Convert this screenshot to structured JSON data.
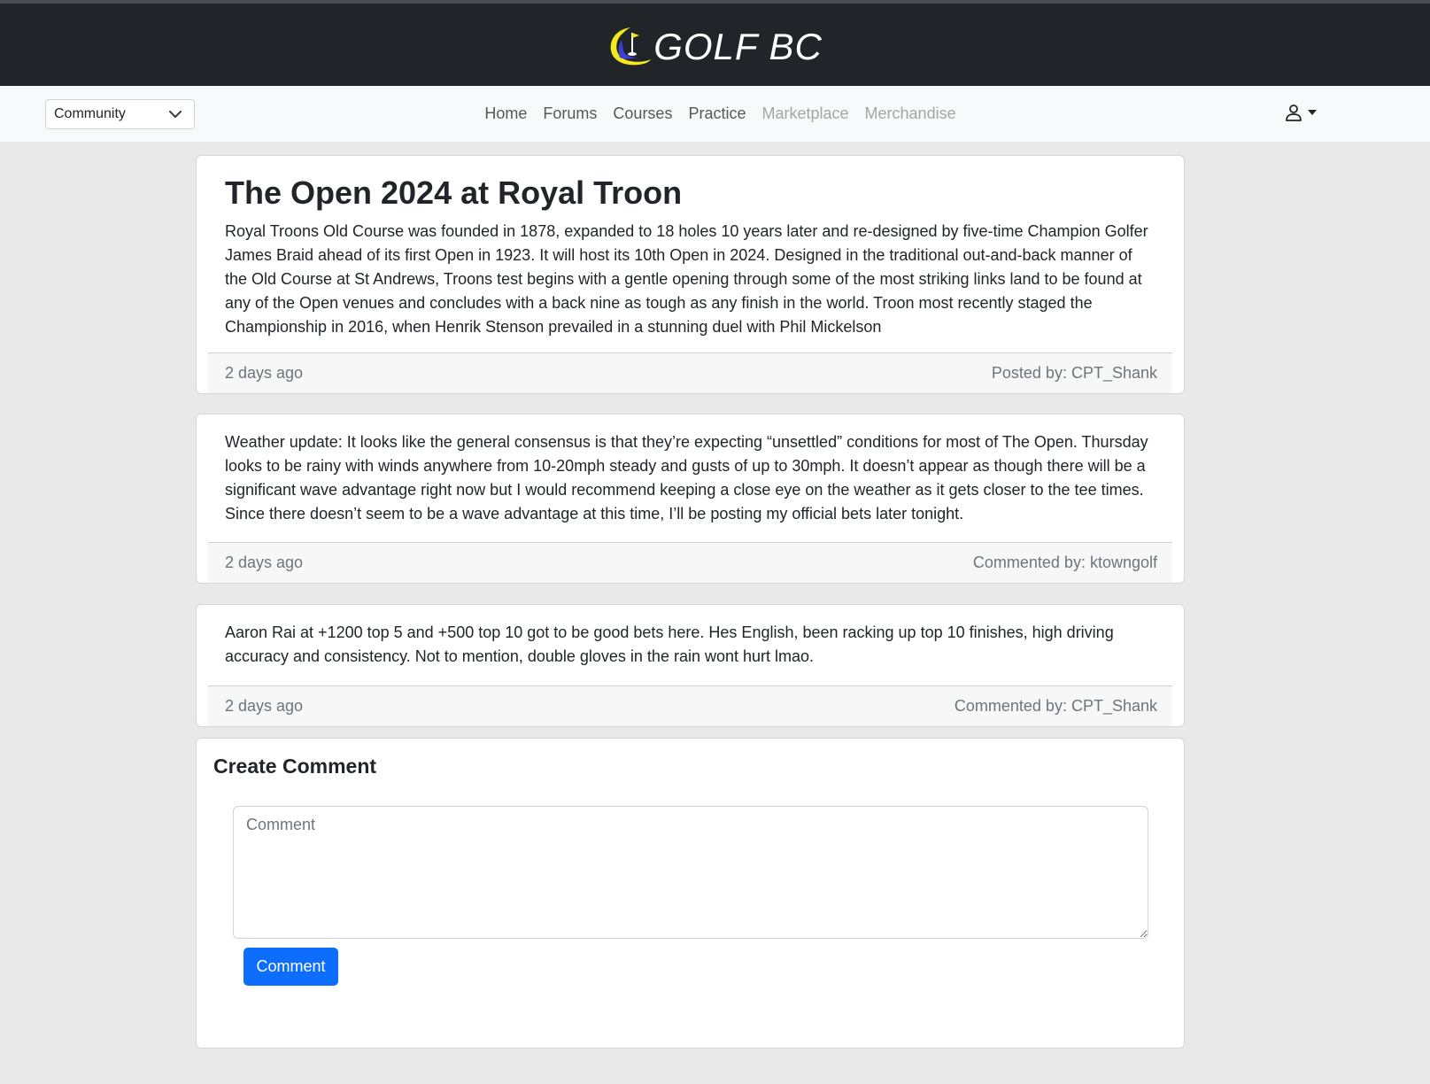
{
  "brand": {
    "name": "GOLF BC"
  },
  "nav": {
    "category_select": "Community",
    "links": [
      {
        "label": "Home",
        "enabled": true
      },
      {
        "label": "Forums",
        "enabled": true
      },
      {
        "label": "Courses",
        "enabled": true
      },
      {
        "label": "Practice",
        "enabled": true
      },
      {
        "label": "Marketplace",
        "enabled": false
      },
      {
        "label": "Merchandise",
        "enabled": false
      }
    ],
    "user_icon": "person-icon"
  },
  "post": {
    "title": "The Open 2024 at Royal Troon",
    "body": "Royal Troons Old Course was founded in 1878, expanded to 18 holes 10 years later and re-designed by five-time Champion Golfer James Braid ahead of its first Open in 1923. It will host its 10th Open in 2024. Designed in the traditional out-and-back manner of the Old Course at St Andrews, Troons test begins with a gentle opening through some of the most striking links land to be found at any of the Open venues and concludes with a back nine as tough as any finish in the world. Troon most recently staged the Championship in 2016, when Henrik Stenson prevailed in a stunning duel with Phil Mickelson",
    "time": "2 days ago",
    "author": "Posted by: CPT_Shank"
  },
  "comments": [
    {
      "body": "Weather update: It looks like the general consensus is that they’re expecting “unsettled” conditions for most of The Open. Thursday looks to be rainy with winds anywhere from 10-20mph steady and gusts of up to 30mph. It doesn’t appear as though there will be a significant wave advantage right now but I would recommend keeping a close eye on the weather as it gets closer to the tee times. Since there doesn’t seem to be a wave advantage at this time, I’ll be posting my official bets later tonight.",
      "time": "2 days ago",
      "author": "Commented by: ktowngolf"
    },
    {
      "body": "Aaron Rai at +1200 top 5 and +500 top 10 got to be good bets here. Hes English, been racking up top 10 finishes, high driving accuracy and consistency. Not to mention, double gloves in the rain wont hurt lmao.",
      "time": "2 days ago",
      "author": "Commented by: CPT_Shank"
    }
  ],
  "create_comment": {
    "title": "Create Comment",
    "placeholder": "Comment",
    "button_label": "Comment"
  },
  "colors": {
    "header_bg": "#212429",
    "navbar_bg": "#f8f9fa",
    "page_bg": "#e9e9e9",
    "primary_button": "#0d6efd",
    "logo_yellow": "#f2ea1c",
    "logo_blue": "#3b3fd6"
  }
}
